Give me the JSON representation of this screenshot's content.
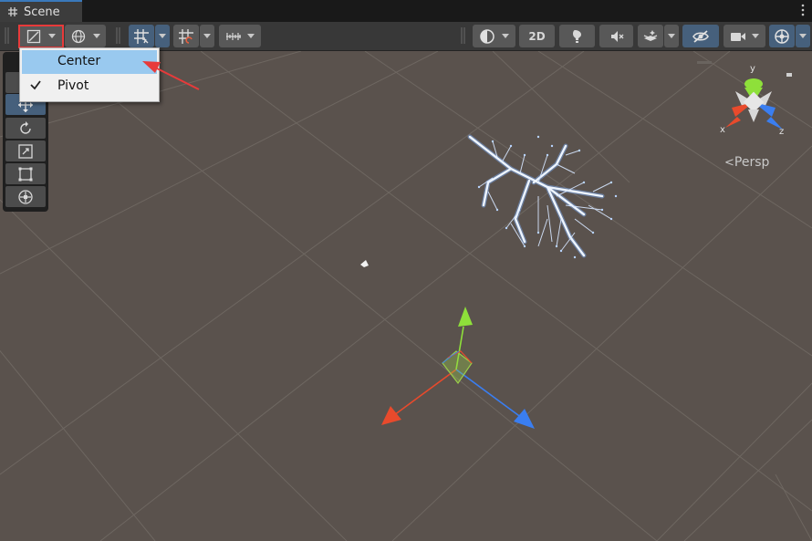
{
  "tab": {
    "title": "Scene",
    "icon": "grid-hash-icon"
  },
  "toolbar": {
    "pivot_mode_icon": "pivot-mode-icon",
    "global_icon": "global-icon",
    "grid_snap_icon": "grid-snap-icon",
    "increment_snap_icon": "increment-snap-icon",
    "ruler_icon": "ruler-icon",
    "shading_icon": "shading-mode-icon",
    "mode_2d_label": "2D",
    "lighting_icon": "lighting-icon",
    "audio_icon": "audio-icon",
    "effects_icon": "effects-icon",
    "visibility_icon": "scene-visibility-icon",
    "camera_icon": "camera-icon",
    "gizmos_icon": "gizmos-icon"
  },
  "dropdown": {
    "items": [
      {
        "label": "Center",
        "checked": false,
        "highlighted": true
      },
      {
        "label": "Pivot",
        "checked": true,
        "highlighted": false
      }
    ]
  },
  "tools": [
    "view-tool",
    "move-tool",
    "rotate-tool",
    "scale-tool",
    "rect-tool",
    "transform-tool"
  ],
  "gizmo": {
    "x_label": "x",
    "y_label": "y",
    "z_label": "z",
    "projection_label": "Persp"
  },
  "colors": {
    "accent_active": "#46607c",
    "highlight_red": "#e83a3a",
    "viewport_bg": "#5a524d",
    "menu_highlight": "#99c9ef",
    "x_axis": "#e84a2c",
    "y_axis": "#8ee03a",
    "z_axis": "#3a7ef0"
  }
}
